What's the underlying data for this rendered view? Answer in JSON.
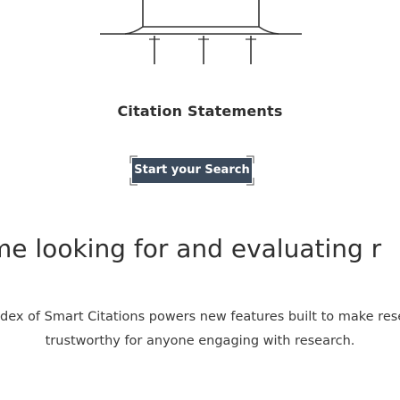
{
  "feature": {
    "title": "Citation Statements",
    "cta_label": "Start your Search"
  },
  "hero": {
    "headline": "me looking for and evaluating r",
    "description_line1": "dex of Smart Citations powers new features built to make resea",
    "description_line2": "trustworthy for anyone engaging with research."
  },
  "colors": {
    "button_bg": "#3b4a5c",
    "text": "#2f2f2f",
    "illustration_stroke": "#333333"
  }
}
